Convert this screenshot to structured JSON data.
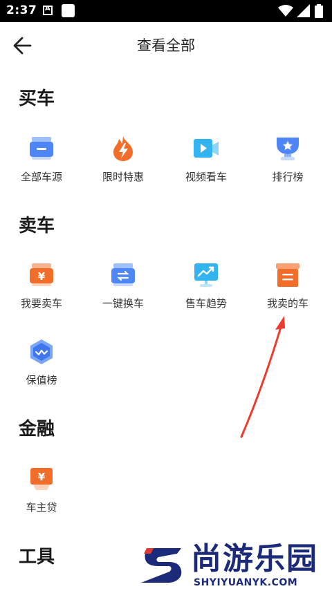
{
  "status_bar": {
    "time": "2:37"
  },
  "header": {
    "title": "查看全部"
  },
  "sections": [
    {
      "title": "买车",
      "items": [
        {
          "label": "全部车源",
          "icon": "car-list-icon"
        },
        {
          "label": "限时特惠",
          "icon": "flame-icon"
        },
        {
          "label": "视频看车",
          "icon": "video-camera-icon"
        },
        {
          "label": "排行榜",
          "icon": "trophy-icon"
        }
      ]
    },
    {
      "title": "卖车",
      "items": [
        {
          "label": "我要卖车",
          "icon": "sell-car-icon"
        },
        {
          "label": "一键换车",
          "icon": "swap-car-icon"
        },
        {
          "label": "售车趋势",
          "icon": "trend-chart-icon"
        },
        {
          "label": "我卖的车",
          "icon": "box-icon"
        },
        {
          "label": "保值榜",
          "icon": "shield-icon"
        }
      ]
    },
    {
      "title": "金融",
      "items": [
        {
          "label": "车主贷",
          "icon": "loan-icon"
        }
      ]
    },
    {
      "title": "工具",
      "items": []
    }
  ],
  "watermark": {
    "brand": "尚游乐园",
    "site": "SHYIYUANYK.COM"
  },
  "colors": {
    "blue": "#4f86f7",
    "orange": "#f36d2a",
    "cyan": "#33b3f0",
    "annotation": "#ee3b2f"
  }
}
